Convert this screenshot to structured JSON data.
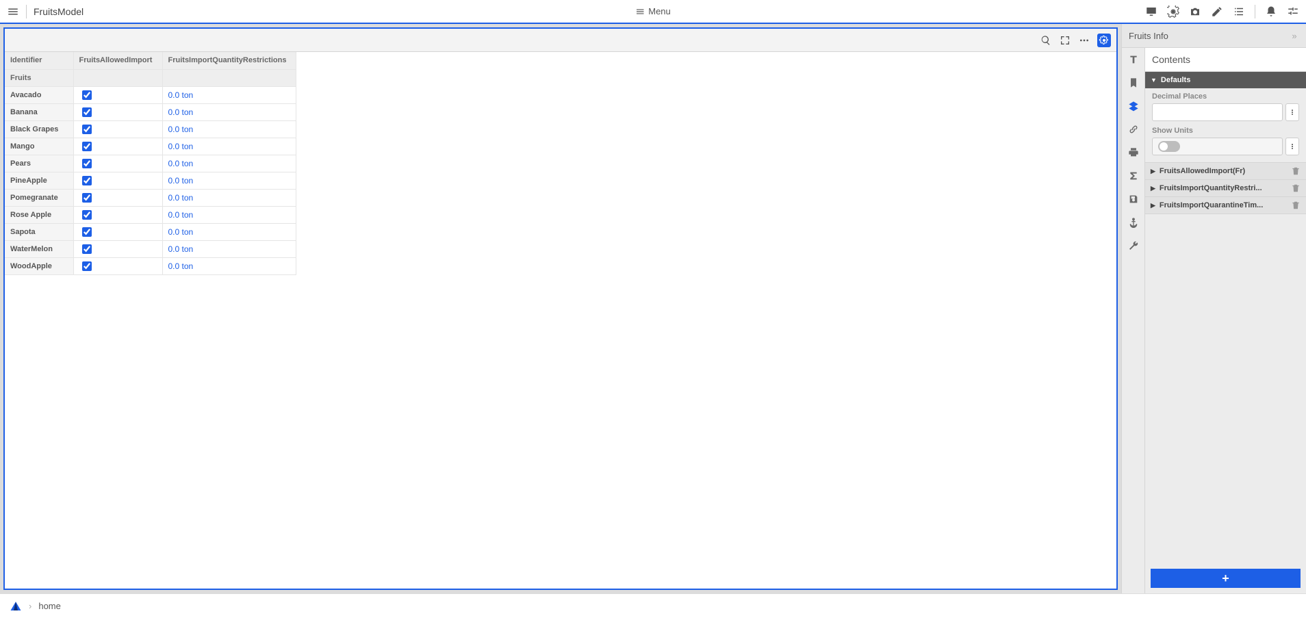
{
  "header": {
    "title": "FruitsModel",
    "menu_label": "Menu"
  },
  "table": {
    "col_identifier": "Identifier",
    "col_allowed": "FruitsAllowedImport",
    "col_qty": "FruitsImportQuantityRestrictions",
    "row_set_label": "Fruits",
    "rows": [
      {
        "name": "Avacado",
        "allowed": true,
        "qty": "0.0 ton",
        "editing": true
      },
      {
        "name": "Banana",
        "allowed": true,
        "qty": "0.0 ton"
      },
      {
        "name": "Black Grapes",
        "allowed": true,
        "qty": "0.0 ton"
      },
      {
        "name": "Mango",
        "allowed": true,
        "qty": "0.0 ton"
      },
      {
        "name": "Pears",
        "allowed": true,
        "qty": "0.0 ton"
      },
      {
        "name": "PineApple",
        "allowed": true,
        "qty": "0.0 ton"
      },
      {
        "name": "Pomegranate",
        "allowed": true,
        "qty": "0.0 ton"
      },
      {
        "name": "Rose Apple",
        "allowed": true,
        "qty": "0.0 ton"
      },
      {
        "name": "Sapota",
        "allowed": true,
        "qty": "0.0 ton"
      },
      {
        "name": "WaterMelon",
        "allowed": true,
        "qty": "0.0 ton"
      },
      {
        "name": "WoodApple",
        "allowed": true,
        "qty": "0.0 ton"
      }
    ]
  },
  "sidebar": {
    "panel_title": "Fruits Info",
    "contents_title": "Contents",
    "defaults_label": "Defaults",
    "decimal_label": "Decimal Places",
    "show_units_label": "Show Units",
    "decimal_value": "",
    "sections": [
      {
        "label": "FruitsAllowedImport(Fr)"
      },
      {
        "label": "FruitsImportQuantityRestri..."
      },
      {
        "label": "FruitsImportQuarantineTim..."
      }
    ],
    "add_label": "+"
  },
  "status": {
    "crumb": "home"
  }
}
